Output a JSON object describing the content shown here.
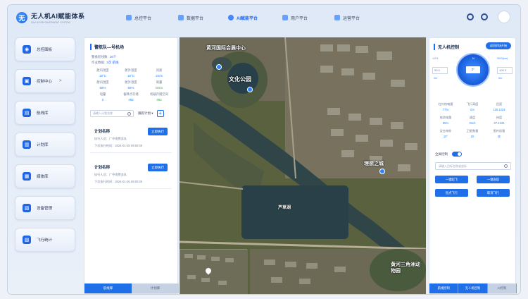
{
  "app": {
    "title": "无人机AI赋能体系",
    "subtitle": "UAV AI EMPOWERMENT SYSTEM",
    "logo_glyph": "无"
  },
  "nav": [
    {
      "label": "总控平台",
      "active": false
    },
    {
      "label": "数据平台",
      "active": false
    },
    {
      "label": "AI赋能平台",
      "active": true
    },
    {
      "label": "用户平台",
      "active": false
    },
    {
      "label": "运营平台",
      "active": false
    }
  ],
  "sidebar": {
    "items": [
      {
        "label": "总控面板",
        "icon": "dashboard-icon",
        "glyph": "◉"
      },
      {
        "label": "控制中心",
        "icon": "control-icon",
        "glyph": "▣",
        "arrow": ">"
      },
      {
        "label": "航线库",
        "icon": "route-icon",
        "glyph": "▤"
      },
      {
        "label": "计划库",
        "icon": "plan-icon",
        "glyph": "▥"
      },
      {
        "label": "媒体库",
        "icon": "media-icon",
        "glyph": "▦"
      },
      {
        "label": "设备管理",
        "icon": "device-icon",
        "glyph": "▧"
      },
      {
        "label": "飞行统计",
        "icon": "stats-icon",
        "glyph": "▨"
      }
    ]
  },
  "left_panel": {
    "title": "警航队—号机场",
    "info": [
      {
        "label": "警备航线数:",
        "value": "16个"
      },
      {
        "label": "作业数据:",
        "value": "3次 航线"
      }
    ],
    "stats": [
      {
        "label": "舱内温度",
        "value": "18°C"
      },
      {
        "label": "舱外温度",
        "value": "16°C"
      },
      {
        "label": "风速",
        "value": "2m/s"
      },
      {
        "label": "舱内湿度",
        "value": "58%"
      },
      {
        "label": "舱外湿度",
        "value": "56%"
      },
      {
        "label": "雨量",
        "value": "0mm",
        "warn": true
      },
      {
        "label": "电量",
        "value": "0"
      },
      {
        "label": "备降点存储",
        "value": "482"
      },
      {
        "label": "机载存储空间",
        "value": "482",
        "warn": true
      }
    ],
    "search_placeholder": "请输入计划名称",
    "filter_label": "跟踪计划 ▾",
    "add_label": "+",
    "plans": [
      {
        "name": "计划名称",
        "executor": "执行人员：广中南警务队",
        "time": "下次执行时间：2024-01-25 09:00:00",
        "button": "立即执行"
      },
      {
        "name": "计划名称",
        "executor": "执行人员：广中南警务队",
        "time": "下次执行时间：2024-01-25 09:00:00",
        "button": "立即执行"
      }
    ],
    "tabs": [
      {
        "label": "航线库",
        "active": true
      },
      {
        "label": "计划库",
        "active": false
      }
    ]
  },
  "map": {
    "labels": [
      {
        "text": "黄河国际会展中心"
      },
      {
        "text": "文化公园"
      },
      {
        "text": "理想之城"
      },
      {
        "text": "芦草湖"
      },
      {
        "text": "黄河三角洲动物园"
      }
    ]
  },
  "right_panel": {
    "title": "无人机控制",
    "top_button": "返回机场开始",
    "compass": {
      "north": "N",
      "value": "0°",
      "left_label": "90.0",
      "left_sub": "0m",
      "right_label": "100.0",
      "right_sub": "0m",
      "top_right": "SDS(km)",
      "bottom_left": "1.0/1"
    },
    "stats": [
      {
        "label": "红外热电量",
        "value": "77%"
      },
      {
        "label": "飞行高度",
        "value": "0m"
      },
      {
        "label": "经度",
        "value": "118.1234"
      },
      {
        "label": "电池电量",
        "value": "95%"
      },
      {
        "label": "速度",
        "value": "0m/s"
      },
      {
        "label": "纬度",
        "value": "37.1234"
      },
      {
        "label": "云台俯仰",
        "value": "10°"
      },
      {
        "label": "卫星数量",
        "value": "20"
      },
      {
        "label": "图传质量",
        "value": "良"
      }
    ],
    "toggle_label": "全屏控制",
    "search_placeholder": "请输入目标名称或坐标",
    "buttons": [
      "一键起飞",
      "一键返航",
      "指点飞行",
      "取消飞行"
    ],
    "tabs": [
      {
        "label": "航线控制",
        "active": true
      },
      {
        "label": "无人机控制",
        "active": true
      },
      {
        "label": "AI控制",
        "active": false
      }
    ]
  }
}
